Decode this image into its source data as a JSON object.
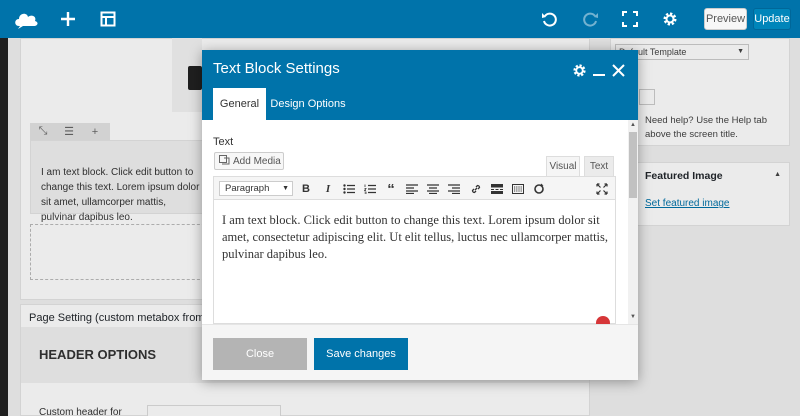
{
  "topbar": {
    "logo_icon": "cloud-logo-icon",
    "add_icon": "plus-icon",
    "layout_icon": "layout-icon",
    "undo_icon": "undo-icon",
    "redo_icon": "redo-icon",
    "fullscreen_icon": "fullscreen-icon",
    "settings_icon": "gear-icon",
    "preview_label": "Preview",
    "update_label": "Update"
  },
  "canvas": {
    "text_block": "I am text block. Click edit button to change this text. Lorem ipsum dolor sit amet, ullamcorper mattis, pulvinar dapibus leo.",
    "row_controls": [
      "⤡",
      "☰",
      "+"
    ]
  },
  "page_setting": {
    "title": "Page Setting (custom metabox from the",
    "header_options": "HEADER OPTIONS",
    "custom_header_label": "Custom header for"
  },
  "sidebar": {
    "template_select": "Default Template",
    "help_text": "Need help? Use the Help tab above the screen title.",
    "featured_title": "Featured Image",
    "featured_link": "Set featured image"
  },
  "modal": {
    "title": "Text Block Settings",
    "tabs": [
      {
        "label": "General",
        "active": true
      },
      {
        "label": "Design Options",
        "active": false
      }
    ],
    "text_label": "Text",
    "add_media_label": "Add Media",
    "mode_visual": "Visual",
    "mode_text": "Text",
    "format_select": "Paragraph",
    "content": "I am text block. Click edit button to change this text. Lorem ipsum dolor sit amet, consectetur adipiscing elit. Ut elit tellus, luctus nec ullamcorper mattis, pulvinar dapibus leo.",
    "close_label": "Close",
    "save_label": "Save changes"
  },
  "colors": {
    "accent": "#0073aa",
    "close_button": "#b4b4b4",
    "spellcheck": "#d63638"
  }
}
